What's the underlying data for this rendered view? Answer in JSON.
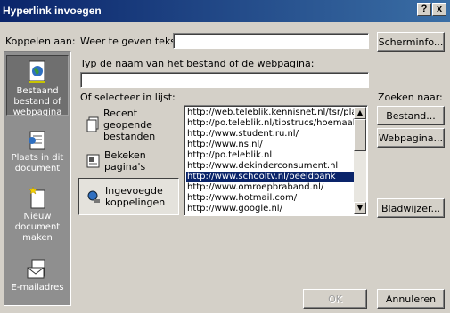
{
  "window": {
    "title": "Hyperlink invoegen",
    "help_label": "?",
    "close_label": "x"
  },
  "link_to": {
    "label": "Koppelen aan:",
    "items": [
      {
        "label": "Bestaand bestand of webpagina",
        "icon": "globe-page-icon",
        "active": true
      },
      {
        "label": "Plaats in dit document",
        "icon": "document-place-icon",
        "active": false
      },
      {
        "label": "Nieuw document maken",
        "icon": "new-document-icon",
        "active": false
      },
      {
        "label": "E-mailadres",
        "icon": "email-icon",
        "active": false
      }
    ]
  },
  "text_to_display": {
    "label": "Weer te geven tekst:",
    "value": ""
  },
  "screentip_button": "Scherminfo...",
  "address": {
    "label": "Typ de naam van het bestand of de webpagina:",
    "value": ""
  },
  "select_label": "Of selecteer in lijst:",
  "search_label": "Zoeken naar:",
  "browse_buttons": {
    "file": "Bestand...",
    "web": "Webpagina..."
  },
  "categories": [
    {
      "label": "Recent geopende bestanden",
      "icon": "recent-files-icon",
      "pressed": false
    },
    {
      "label": "Bekeken pagina's",
      "icon": "browsed-pages-icon",
      "pressed": false
    },
    {
      "label": "Ingevoegde koppelingen",
      "icon": "inserted-links-icon",
      "pressed": true
    }
  ],
  "links": [
    "http://web.teleblik.kennisnet.nl/tsr/player",
    "http://po.teleblik.nl/tipstrucs/hoemaakik",
    "http://www.student.ru.nl/",
    "http://www.ns.nl/",
    "http://po.teleblik.nl",
    "http://www.dekinderconsument.nl",
    "http://www.schooltv.nl/beeldbank",
    "http://www.omroepbraband.nl/",
    "http://www.hotmail.com/",
    "http://www.google.nl/"
  ],
  "selected_link_index": 6,
  "bookmark_button": "Bladwijzer...",
  "ok_button": "OK",
  "cancel_button": "Annuleren",
  "colors": {
    "title_start": "#0a246a",
    "title_end": "#3a6ea5",
    "selection": "#0a246a",
    "face": "#d4d0c8",
    "sidebar": "#8f8f8f"
  }
}
